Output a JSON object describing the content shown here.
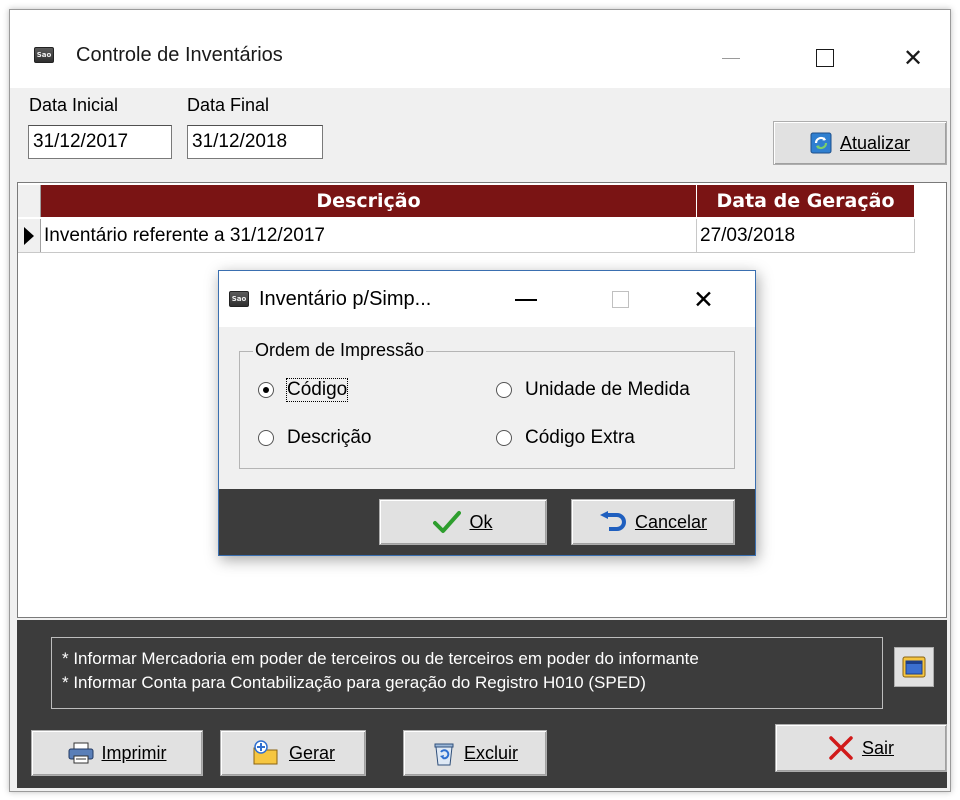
{
  "window": {
    "title": "Controle de Inventários",
    "icon_text": "Sao"
  },
  "filters": {
    "data_inicial_label": "Data Inicial",
    "data_inicial_value": "31/12/2017",
    "data_final_label": "Data Final",
    "data_final_value": "31/12/2018",
    "atualizar_label": "Atualizar"
  },
  "grid": {
    "columns": [
      "Descrição",
      "Data de Geração"
    ],
    "rows": [
      {
        "descricao": "Inventário referente a 31/12/2017",
        "data_geracao": "27/03/2018"
      }
    ],
    "header_color": "#7a1414"
  },
  "info": {
    "line1": "* Informar Mercadoria em poder de terceiros ou de terceiros em poder do informante",
    "line2": "* Informar Conta para Contabilização para geração do Registro H010 (SPED)"
  },
  "buttons": {
    "imprimir": "Imprimir",
    "gerar": "Gerar",
    "excluir": "Excluir",
    "sair": "Sair"
  },
  "dialog": {
    "title": "Inventário p/Simp...",
    "group_label": "Ordem de Impressão",
    "options": [
      {
        "label": "Código",
        "selected": true
      },
      {
        "label": "Unidade de Medida",
        "selected": false
      },
      {
        "label": "Descrição",
        "selected": false
      },
      {
        "label": "Código Extra",
        "selected": false
      }
    ],
    "ok_label": "Ok",
    "cancel_label": "Cancelar"
  },
  "colors": {
    "panel_dark": "#3c3c3c",
    "ok_check": "#2e9e2e",
    "sair_x": "#d11a1a"
  }
}
